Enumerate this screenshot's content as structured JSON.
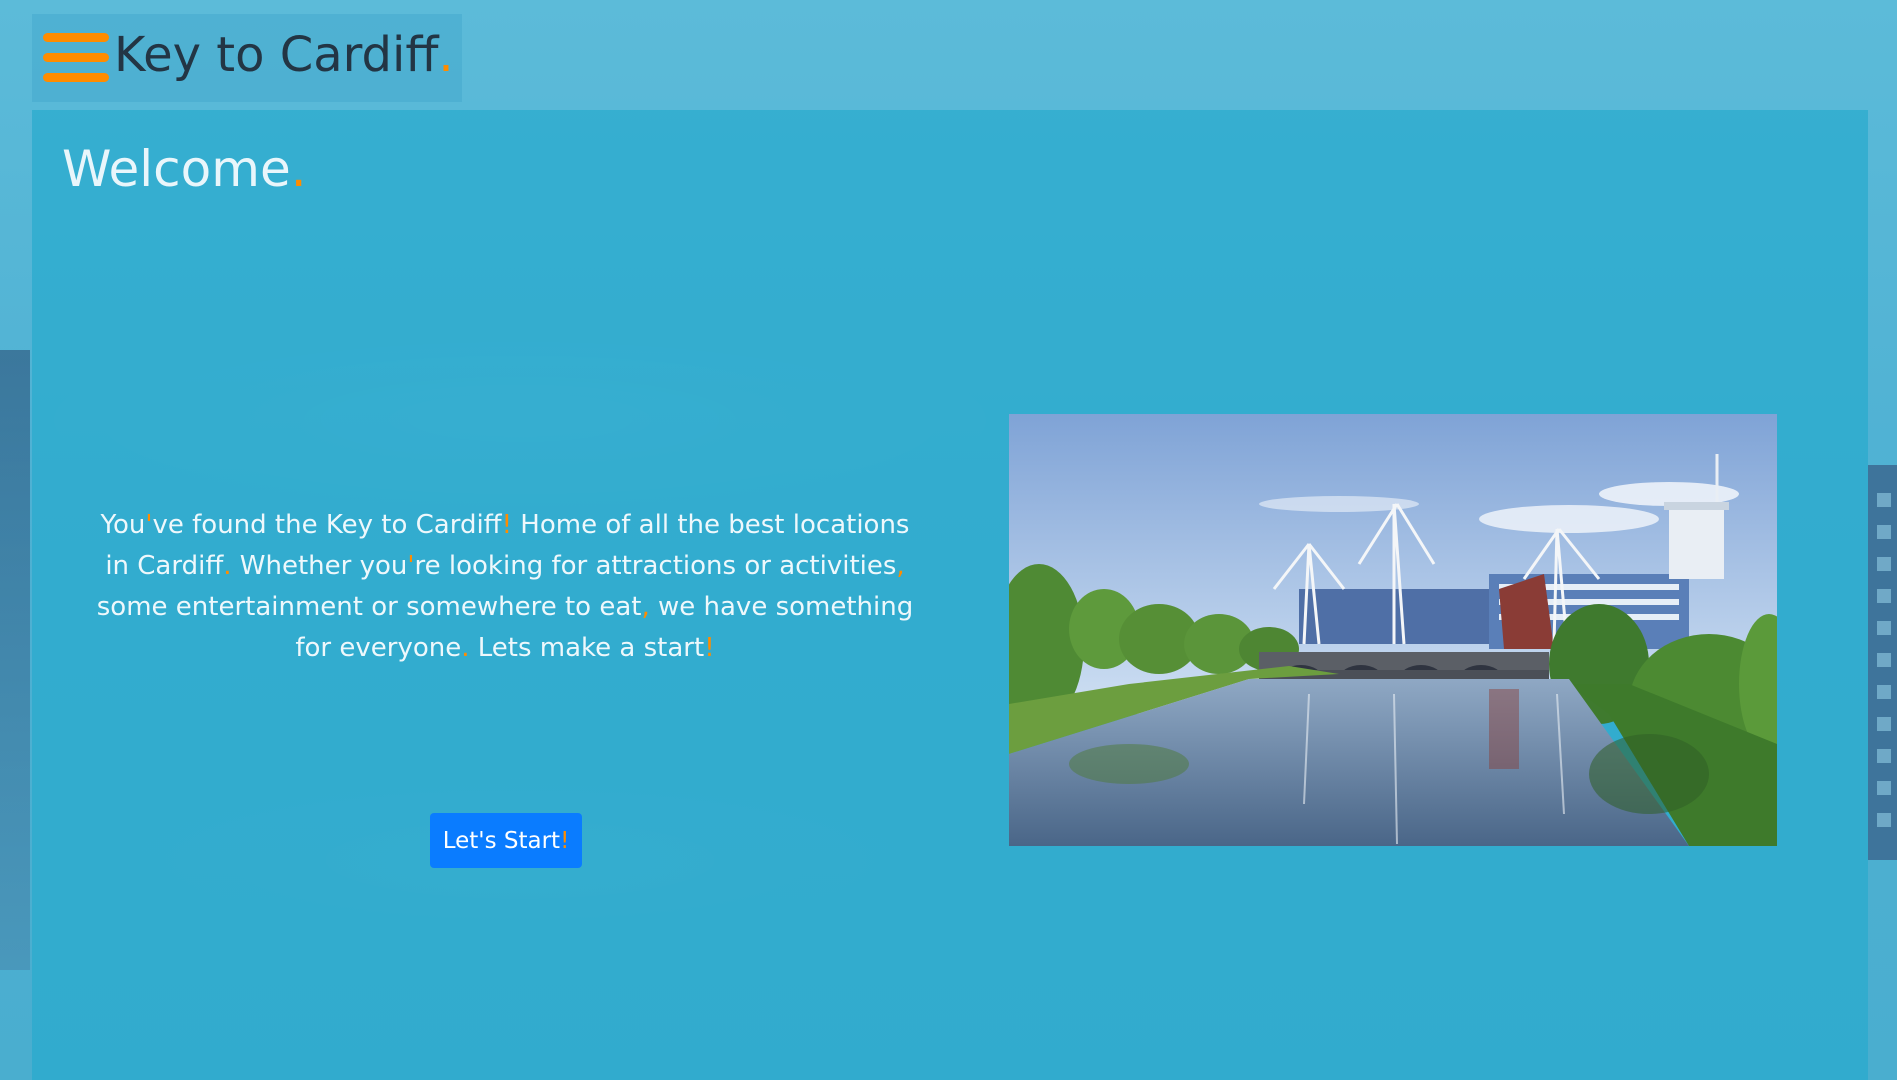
{
  "header": {
    "brand_text": "Key to Cardiff",
    "brand_dot": ".",
    "menu_icon": "hamburger-menu-icon"
  },
  "main": {
    "title": "Welcome",
    "title_dot": ".",
    "intro": {
      "s1": "You",
      "s2": "'",
      "s3": "ve found the Key to Cardiff",
      "s4": "!",
      "s5": " Home of all the best locations in Cardiff",
      "s6": ".",
      "s7": " Whether you",
      "s8": "'",
      "s9": "re looking for attractions or activities",
      "s10": ",",
      "s11": " some entertainment or somewhere to eat",
      "s12": ",",
      "s13": " we have something for everyone",
      "s14": ".",
      "s15": " Lets make a start",
      "s16": "!"
    },
    "start_button": {
      "label": "Let's Start",
      "mark": "!"
    },
    "image_subject": "Cardiff riverside with Principality Stadium"
  },
  "colors": {
    "accent": "#ff8c00",
    "button": "#0a7cff",
    "panel": "#28aacd",
    "brand_text": "#233544"
  }
}
